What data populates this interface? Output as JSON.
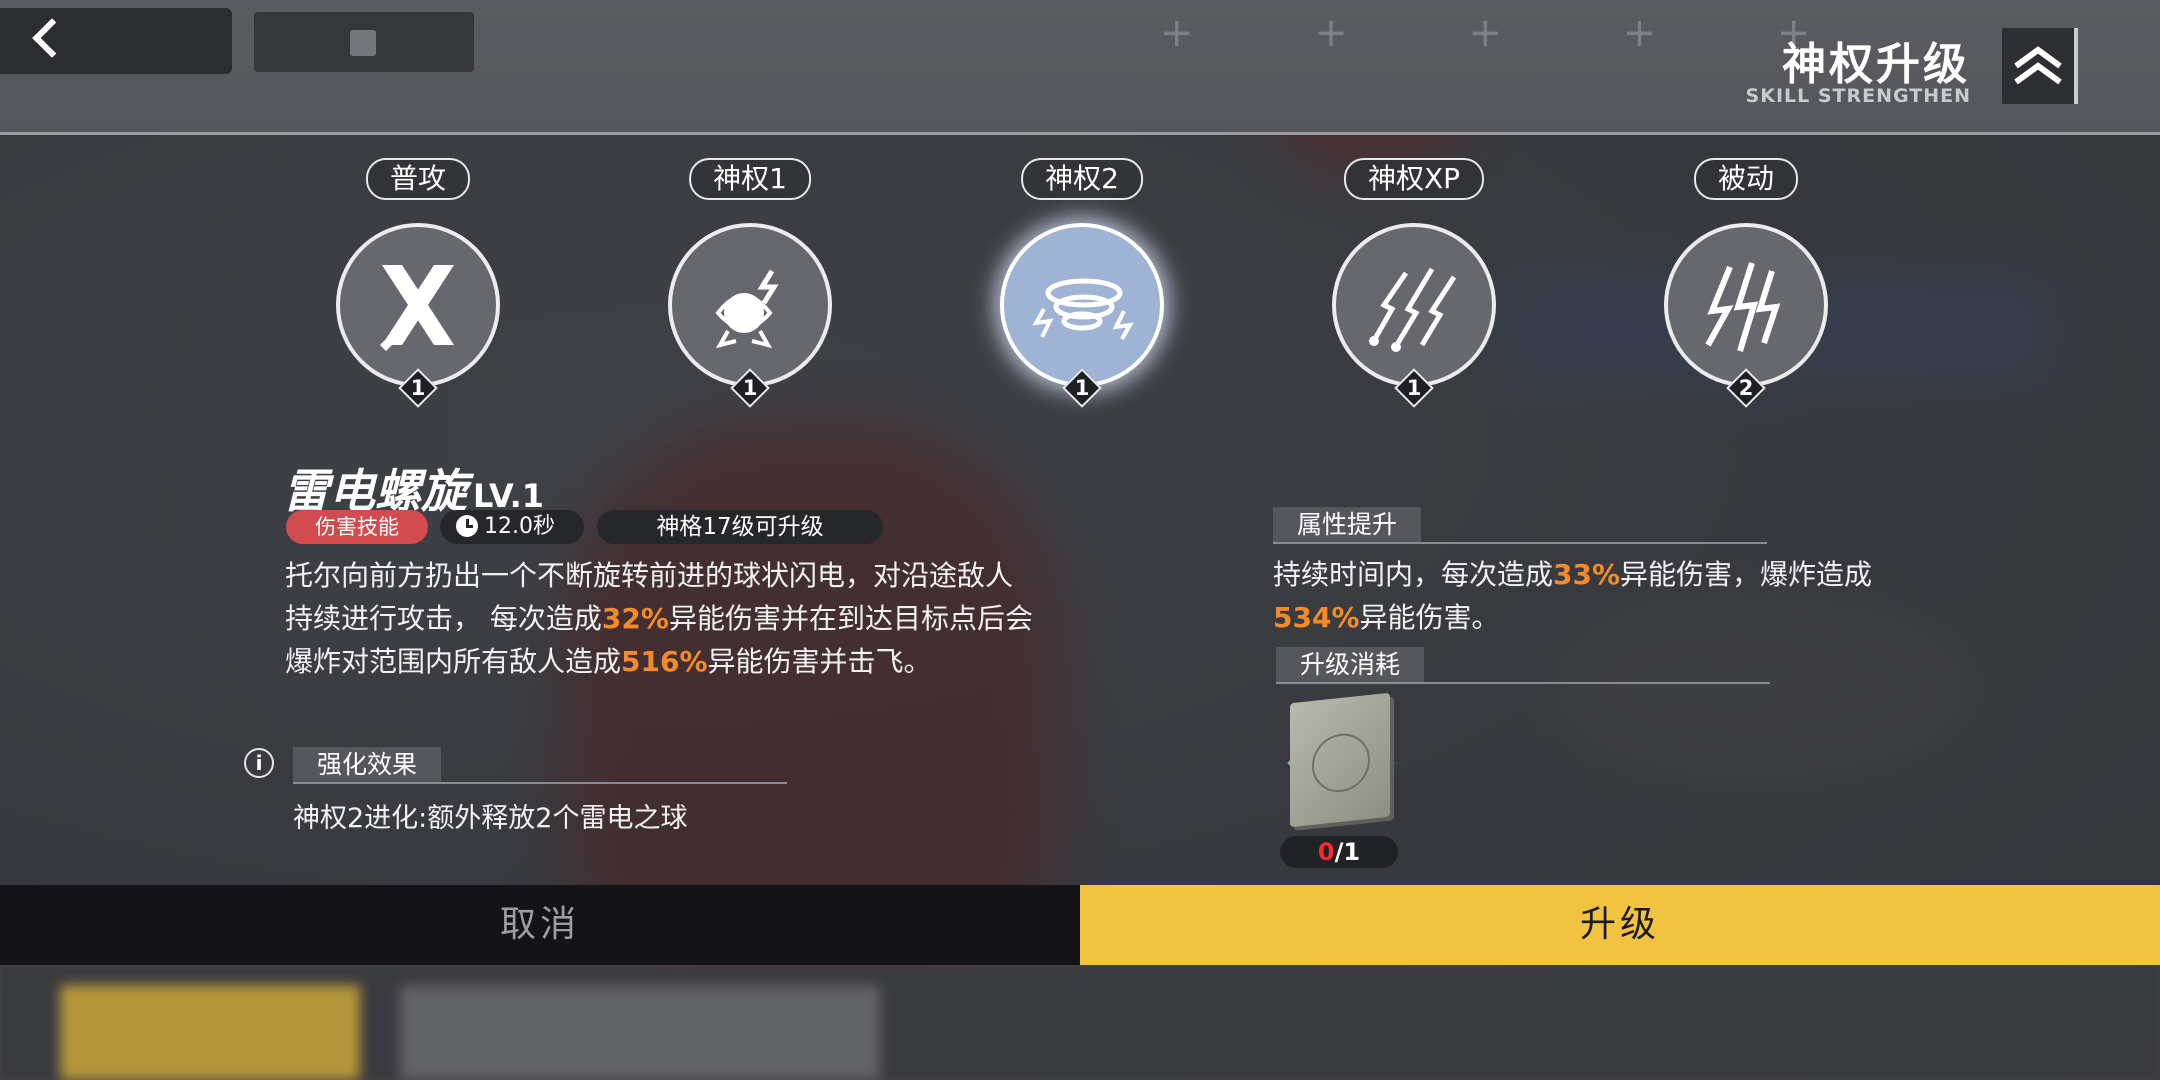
{
  "header": {
    "title": "神权升级",
    "subtitle": "SKILL STRENGTHEN",
    "back_icon": "back-chevron-icon",
    "strengthen_icon": "double-chevron-up-icon"
  },
  "skills": [
    {
      "tab": "普攻",
      "level": "1",
      "icon": "crossed-blades-icon",
      "active": false
    },
    {
      "tab": "神权1",
      "level": "1",
      "icon": "lightning-orb-icon",
      "active": false
    },
    {
      "tab": "神权2",
      "level": "1",
      "icon": "lightning-vortex-icon",
      "active": true
    },
    {
      "tab": "神权XP",
      "level": "1",
      "icon": "lightning-claws-icon",
      "active": false
    },
    {
      "tab": "被动",
      "level": "2",
      "icon": "lightning-bolts-icon",
      "active": false
    }
  ],
  "detail": {
    "name": "雷电螺旋",
    "level_label": "LV.1",
    "type_badge": "伤害技能",
    "cooldown": "12.0秒",
    "requirement": "神格17级可升级",
    "desc": {
      "a": "托尔向前方扔出一个不断旋转前进的球状闪电，对沿途敌人",
      "b": "持续进行攻击， 每次造成",
      "b_val": "32%",
      "c": "异能伤害并在到达目标点后会",
      "d": "爆炸对范围内所有敌人造成",
      "d_val": "516%",
      "e": "异能伤害并击飞。"
    },
    "enhance_title": "强化效果",
    "enhance_text": "神权2进化:额外释放2个雷电之球"
  },
  "attr": {
    "title": "属性提升",
    "a": "持续时间内，每次造成",
    "a_val": "33%",
    "b": "异能伤害，爆炸造成",
    "c_val": "534%",
    "d": "异能伤害。"
  },
  "cost": {
    "title": "升级消耗",
    "item_icon": "skill-book-icon",
    "have": "0",
    "need": "/1"
  },
  "buttons": {
    "cancel": "取消",
    "upgrade": "升级"
  },
  "colors": {
    "highlight": "#f58a2a",
    "upgrade_button": "#f1c340",
    "damage_badge": "#d24b4f",
    "cost_insufficient": "#ff2a2a"
  }
}
